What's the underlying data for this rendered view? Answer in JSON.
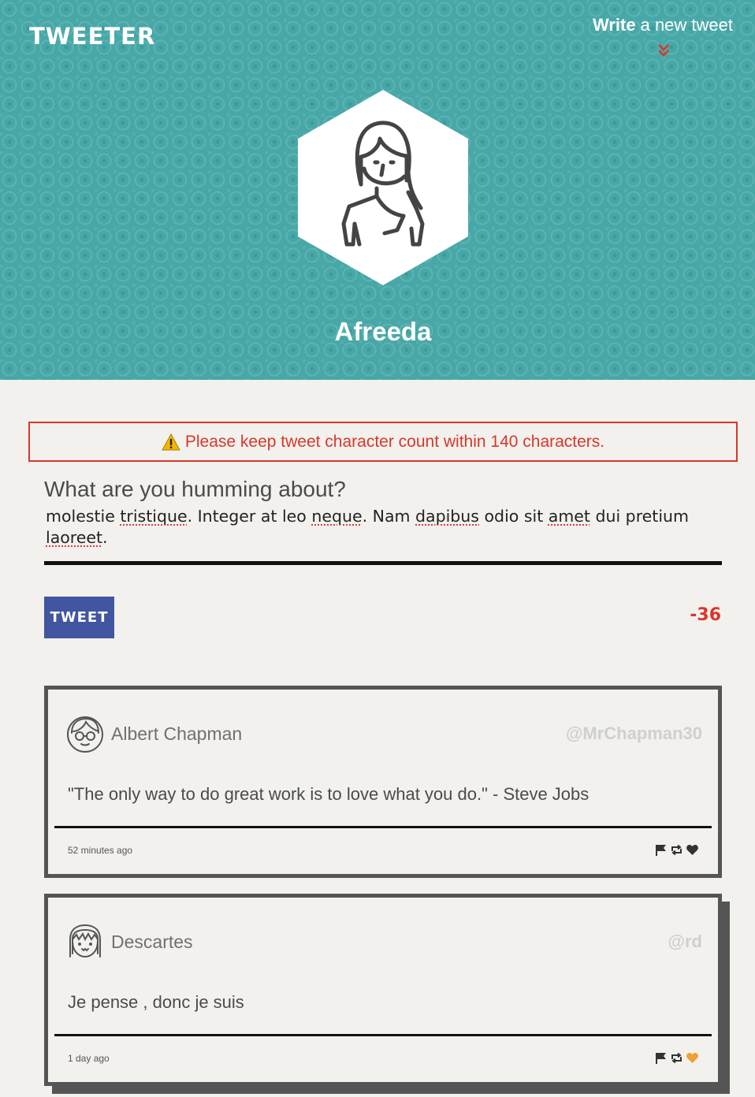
{
  "header": {
    "brand": "TWEETER",
    "compose_strong": "Write",
    "compose_rest": "a new tweet",
    "compose_arrow_icon": "chevron-double-down-icon",
    "profile_name": "Afreeda"
  },
  "composer": {
    "error": "Please keep tweet character count within 140 characters.",
    "label": "What are you humming about?",
    "text": "molestie tristique. Integer at leo neque. Nam dapibus odio sit amet dui pretium laoreet.",
    "text_parts": [
      "molestie ",
      "tristique",
      ". Integer at leo ",
      "neque",
      ". Nam ",
      "dapibus",
      " odio sit ",
      "amet",
      " dui pretium ",
      "laoreet",
      "."
    ],
    "button_label": "TWEET",
    "counter": "-36"
  },
  "tweets": [
    {
      "author": "Albert Chapman",
      "handle": "@MrChapman30",
      "content": "\"The only way to do great work is to love what you do.\" - Steve Jobs",
      "timestamp": "52 minutes ago",
      "liked": false
    },
    {
      "author": "Descartes",
      "handle": "@rd",
      "content": "Je pense , donc je suis",
      "timestamp": "1 day ago",
      "liked": true
    }
  ],
  "colors": {
    "header_bg": "#47a8a7",
    "error": "#d9372b",
    "tweet_button": "#4155a0",
    "like_active": "#f0a030",
    "page_bg": "#f2f1ed"
  }
}
